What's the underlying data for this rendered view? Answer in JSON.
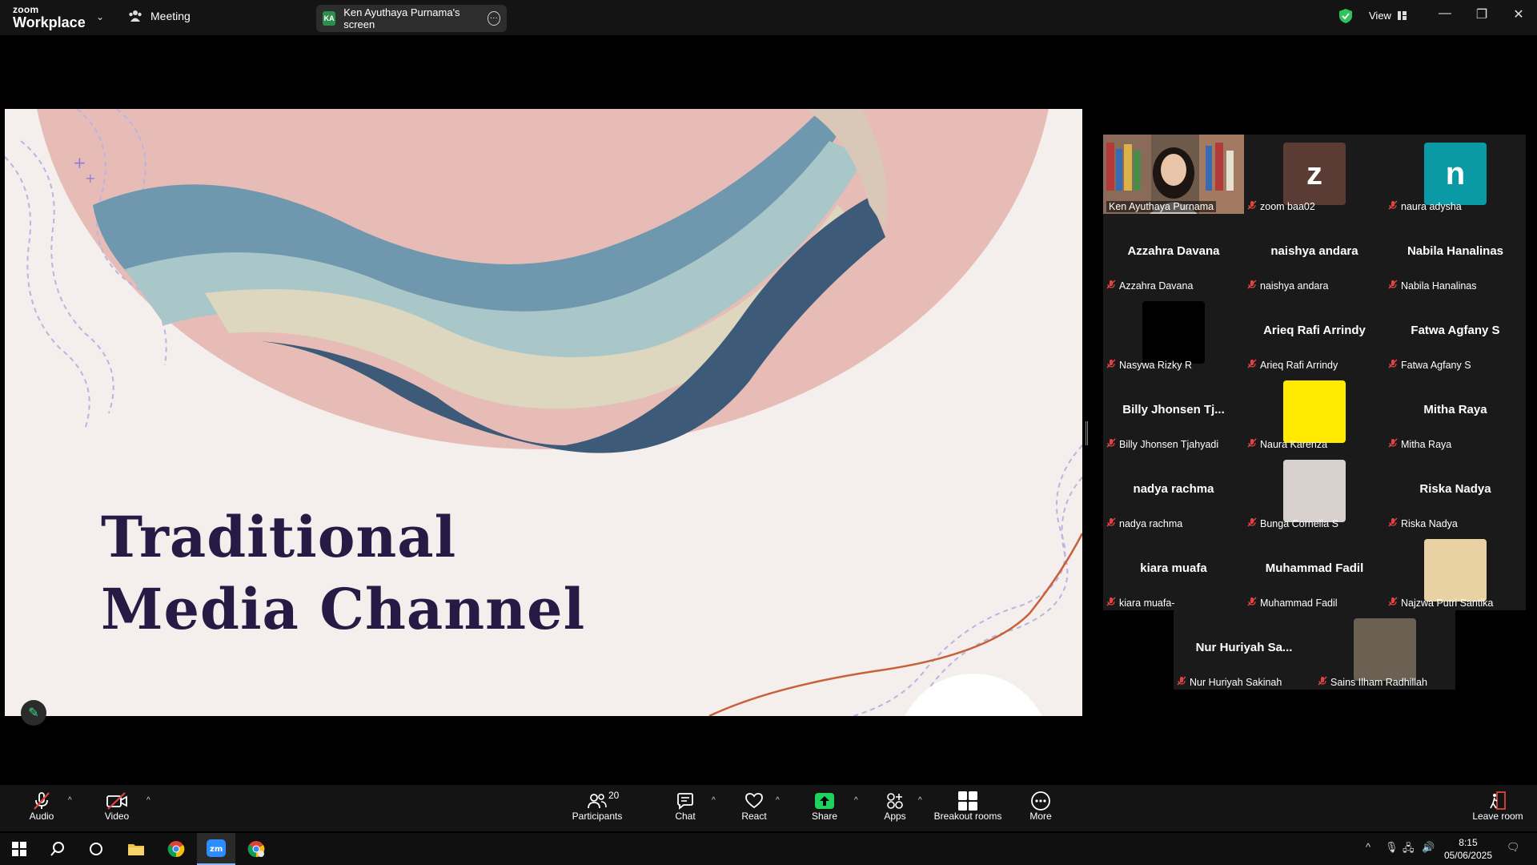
{
  "topbar": {
    "logo_line1": "zoom",
    "logo_line2": "Workplace",
    "meeting_label": "Meeting",
    "screen_owner_initials": "KA",
    "screen_owner_label": "Ken Ayuthaya Purnama's screen",
    "view_label": "View"
  },
  "slide": {
    "title_line1": "Traditional",
    "title_line2": "Media Channel"
  },
  "participants": [
    {
      "display": "Ken Ayuthaya Purnama",
      "type": "video",
      "active": true
    },
    {
      "display": "zoom baa02",
      "type": "avatar",
      "avatar_letter": "z",
      "avatar_color": "#5a3c34"
    },
    {
      "display": "naura adysha",
      "type": "avatar",
      "avatar_letter": "n",
      "avatar_color": "#0a9aa6"
    },
    {
      "display": "Azzahra Davana",
      "type": "name",
      "big_name": "Azzahra Davana"
    },
    {
      "display": "naishya andara",
      "type": "name",
      "big_name": "naishya andara"
    },
    {
      "display": "Nabila Hanalinas",
      "type": "name",
      "big_name": "Nabila Hanalinas"
    },
    {
      "display": "Nasywa Rizky R",
      "type": "avatar",
      "avatar_letter": "",
      "avatar_color": "#000000"
    },
    {
      "display": "Arieq Rafi Arrindy",
      "type": "name",
      "big_name": "Arieq Rafi Arrindy"
    },
    {
      "display": "Fatwa Agfany S",
      "type": "name",
      "big_name": "Fatwa Agfany S"
    },
    {
      "display": "Billy Jhonsen Tjahyadi",
      "type": "name",
      "big_name": "Billy Jhonsen Tj..."
    },
    {
      "display": "Naura Karenza",
      "type": "avatar",
      "avatar_letter": "",
      "avatar_color": "#ffea00"
    },
    {
      "display": "Mitha Raya",
      "type": "name",
      "big_name": "Mitha Raya"
    },
    {
      "display": "nadya rachma",
      "type": "name",
      "big_name": "nadya rachma"
    },
    {
      "display": "Bunga Cornelia S",
      "type": "photo",
      "avatar_color": "#d8d0cc"
    },
    {
      "display": "Riska Nadya",
      "type": "name",
      "big_name": "Riska Nadya"
    },
    {
      "display": "kiara muafa-",
      "type": "name",
      "big_name": "kiara muafa"
    },
    {
      "display": "Muhammad Fadil",
      "type": "name",
      "big_name": "Muhammad Fadil"
    },
    {
      "display": "Najzwa Putri Santika",
      "type": "photo",
      "avatar_color": "#e8d2a4"
    }
  ],
  "participants_row2": [
    {
      "display": "Nur Huriyah Sakinah",
      "type": "name",
      "big_name": "Nur Huriyah Sa..."
    },
    {
      "display": "Sains Ilham Radhillah",
      "type": "photo",
      "avatar_color": "#6b6152"
    }
  ],
  "toolbar": {
    "audio": "Audio",
    "video": "Video",
    "participants": "Participants",
    "participants_count": "20",
    "chat": "Chat",
    "react": "React",
    "share": "Share",
    "apps": "Apps",
    "breakout": "Breakout rooms",
    "more": "More",
    "leave": "Leave room"
  },
  "taskbar": {
    "time": "8:15",
    "date": "05/06/2025"
  },
  "colors": {
    "accent_green": "#25d366",
    "share_green": "#1fd15d",
    "muted_red": "#e0443e",
    "slide_bg": "#f4efec",
    "title_color": "#271a45"
  }
}
